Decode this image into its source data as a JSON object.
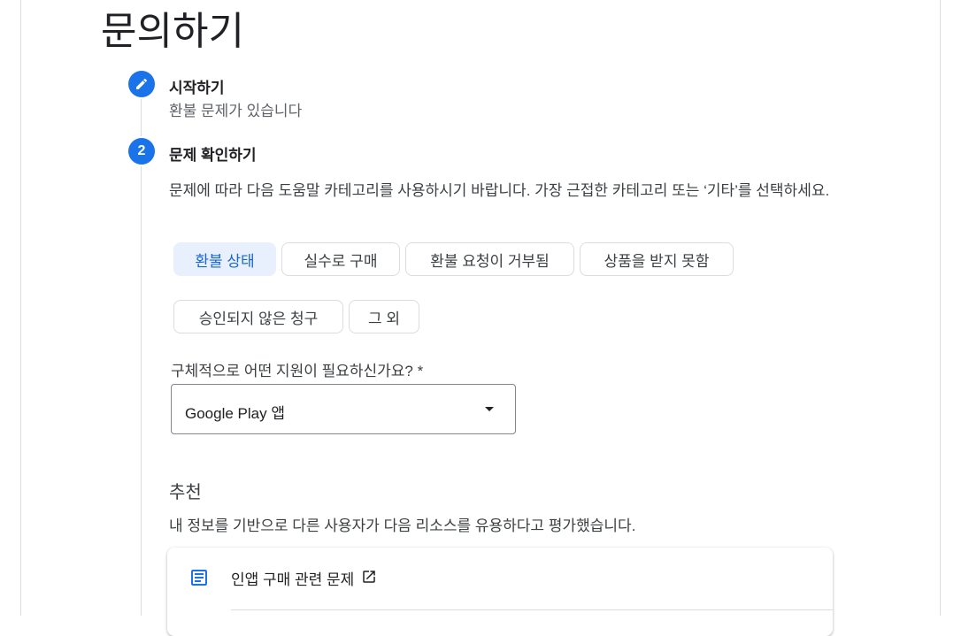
{
  "page": {
    "title": "문의하기"
  },
  "steps": [
    {
      "number": "",
      "title": "시작하기",
      "subtitle": "환불 문제가 있습니다",
      "state": "completed"
    },
    {
      "number": "2",
      "title": "문제 확인하기",
      "state": "active"
    }
  ],
  "description": "문제에 따라 다음 도움말 카테고리를 사용하시기 바랍니다. 가장 근접한 카테고리 또는 ‘기타’를 선택하세요.",
  "categories": [
    {
      "label": "환불 상태",
      "selected": true
    },
    {
      "label": "실수로 구매",
      "selected": false
    },
    {
      "label": "환불 요청이 거부됨",
      "selected": false
    },
    {
      "label": "상품을 받지 못함",
      "selected": false
    },
    {
      "label": "승인되지 않은 청구",
      "selected": false
    },
    {
      "label": "그 외",
      "selected": false
    }
  ],
  "support_field": {
    "label": "구체적으로 어떤 지원이 필요하신가요? *",
    "value": "Google Play 앱"
  },
  "recommendations": {
    "heading": "추천",
    "description": "내 정보를 기반으로 다른 사용자가 다음 리소스를 유용하다고 평가했습니다.",
    "items": [
      {
        "title": "인앱 구매 관련 문제",
        "icon": "article-icon",
        "external": "open-in-new-icon"
      }
    ]
  },
  "colors": {
    "accent": "#1a73e8",
    "chip_selected_bg": "#e8f0fe",
    "chip_selected_text": "#1967d2",
    "border": "#dadce0"
  }
}
